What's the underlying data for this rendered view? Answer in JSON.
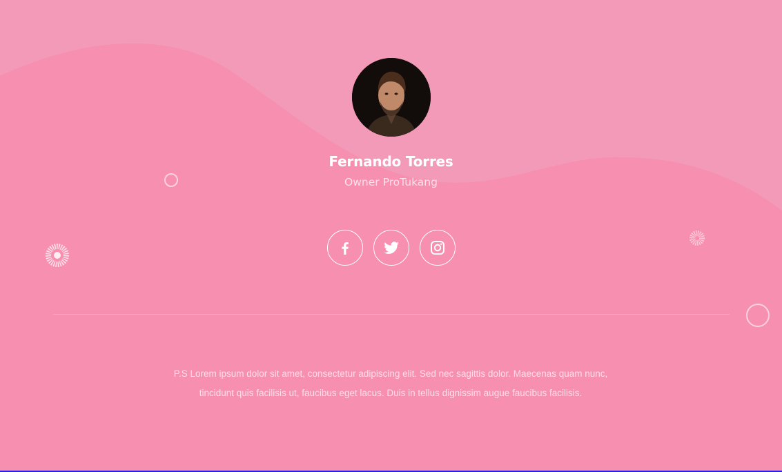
{
  "profile": {
    "name": "Fernando Torres",
    "role": "Owner ProTukang",
    "avatar_icon": "person-portrait"
  },
  "socials": [
    {
      "icon": "facebook-icon",
      "label": "Facebook"
    },
    {
      "icon": "twitter-icon",
      "label": "Twitter"
    },
    {
      "icon": "instagram-icon",
      "label": "Instagram"
    }
  ],
  "note": {
    "line1": "P.S Lorem ipsum dolor sit amet, consectetur adipiscing elit. Sed nec sagittis dolor. Maecenas quam nunc,",
    "line2": "tincidunt quis facilisis ut, faucibus eget lacus. Duis in tellus dignissim augue faucibus facilisis."
  },
  "colors": {
    "background": "#f78fb0",
    "wave_top": "#f39ab8",
    "text_primary": "#ffffff",
    "text_secondary": "#fbe1ea"
  }
}
